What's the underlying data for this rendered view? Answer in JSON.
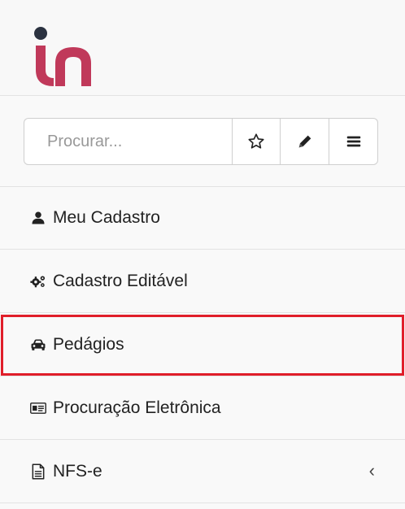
{
  "brand": {
    "accent": "#c0395a",
    "dot": "#2b3240"
  },
  "search": {
    "placeholder": "Procurar..."
  },
  "toolbar": {
    "buttons": [
      {
        "icon": "star-outline-icon"
      },
      {
        "icon": "pencil-icon"
      },
      {
        "icon": "menu-bars-icon"
      }
    ]
  },
  "menu": {
    "items": [
      {
        "label": "Meu Cadastro",
        "icon": "user-icon"
      },
      {
        "label": "Cadastro Editável",
        "icon": "gears-icon"
      },
      {
        "label": "Pedágios",
        "icon": "car-icon",
        "highlighted": true
      },
      {
        "label": "Procuração Eletrônica",
        "icon": "id-card-icon"
      },
      {
        "label": "NFS-e",
        "icon": "document-icon",
        "chevron": "‹"
      }
    ]
  },
  "highlight_color": "#e01e2a"
}
